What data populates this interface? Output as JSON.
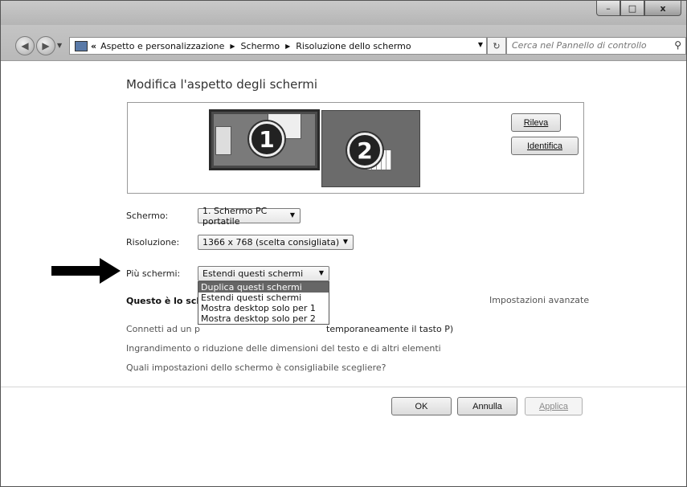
{
  "window": {
    "minimize": "–",
    "maximize": "□",
    "close": "x"
  },
  "nav": {
    "back_glyph": "◀",
    "forward_glyph": "▶",
    "breadcrumb": [
      "Aspetto e personalizzazione",
      "Schermo",
      "Risoluzione dello schermo"
    ],
    "breadcrumb_prefix": "«",
    "search_placeholder": "Cerca nel Pannello di controllo"
  },
  "page": {
    "heading": "Modifica l'aspetto degli schermi",
    "monitor1_number": "1",
    "monitor2_number": "2",
    "rileva_label": "Rileva",
    "identifica_label": "Identifica",
    "schermo_label": "Schermo:",
    "schermo_value": "1. Schermo PC portatile",
    "risoluzione_label": "Risoluzione:",
    "risoluzione_value": "1366 x 768 (scelta consigliata)",
    "multi_label": "Più schermi:",
    "multi_value": "Estendi questi schermi",
    "multi_options": [
      "Duplica questi schermi",
      "Estendi questi schermi",
      "Mostra desktop solo per 1",
      "Mostra desktop solo per 2"
    ],
    "questo_text": "Questo è lo scher",
    "impostazioni_avanzate": "Impostazioni avanzate",
    "connetti_prefix": "Connetti ad un p",
    "connetti_suffix": "temporaneamente il tasto P)",
    "ingrandimento_link": "Ingrandimento o riduzione delle dimensioni del testo e di altri elementi",
    "quali_link": "Quali impostazioni dello schermo è consigliabile scegliere?",
    "ok_label": "OK",
    "annulla_label": "Annulla",
    "applica_label": "Applica"
  }
}
